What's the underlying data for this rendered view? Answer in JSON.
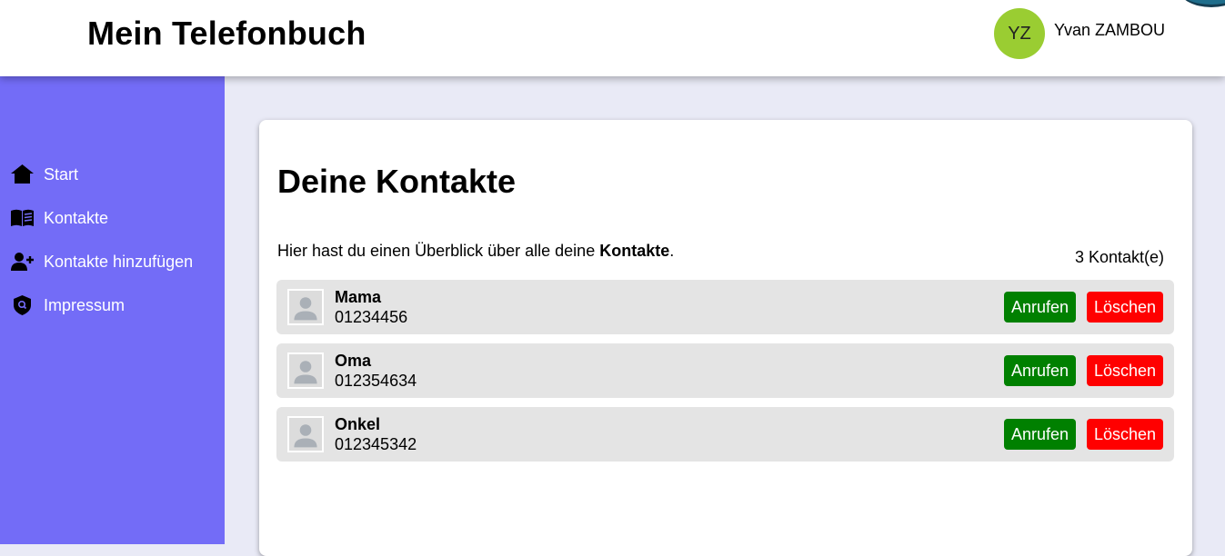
{
  "header": {
    "title": "Mein Telefonbuch",
    "user": {
      "initials": "YZ",
      "name": "Yvan ZAMBOU"
    }
  },
  "sidebar": {
    "items": [
      {
        "label": "Start",
        "icon": "home-icon"
      },
      {
        "label": "Kontakte",
        "icon": "book-icon"
      },
      {
        "label": "Kontakte hinzufügen",
        "icon": "add-user-icon"
      },
      {
        "label": "Impressum",
        "icon": "shield-icon"
      }
    ]
  },
  "main": {
    "heading": "Deine Kontakte",
    "intro_prefix": "Hier hast du einen Überblick über alle deine ",
    "intro_bold": "Kontakte",
    "intro_suffix": ".",
    "count": "3 Kontakt(e)",
    "call_label": "Anrufen",
    "delete_label": "Löschen",
    "contacts": [
      {
        "name": "Mama",
        "number": "01234456"
      },
      {
        "name": "Oma",
        "number": "012354634"
      },
      {
        "name": "Onkel",
        "number": "012345342"
      }
    ]
  },
  "colors": {
    "sidebar": "#736cf7",
    "background": "#e9eaf6",
    "avatar": "#9acd32",
    "call": "#008000",
    "delete": "#ff0000"
  }
}
